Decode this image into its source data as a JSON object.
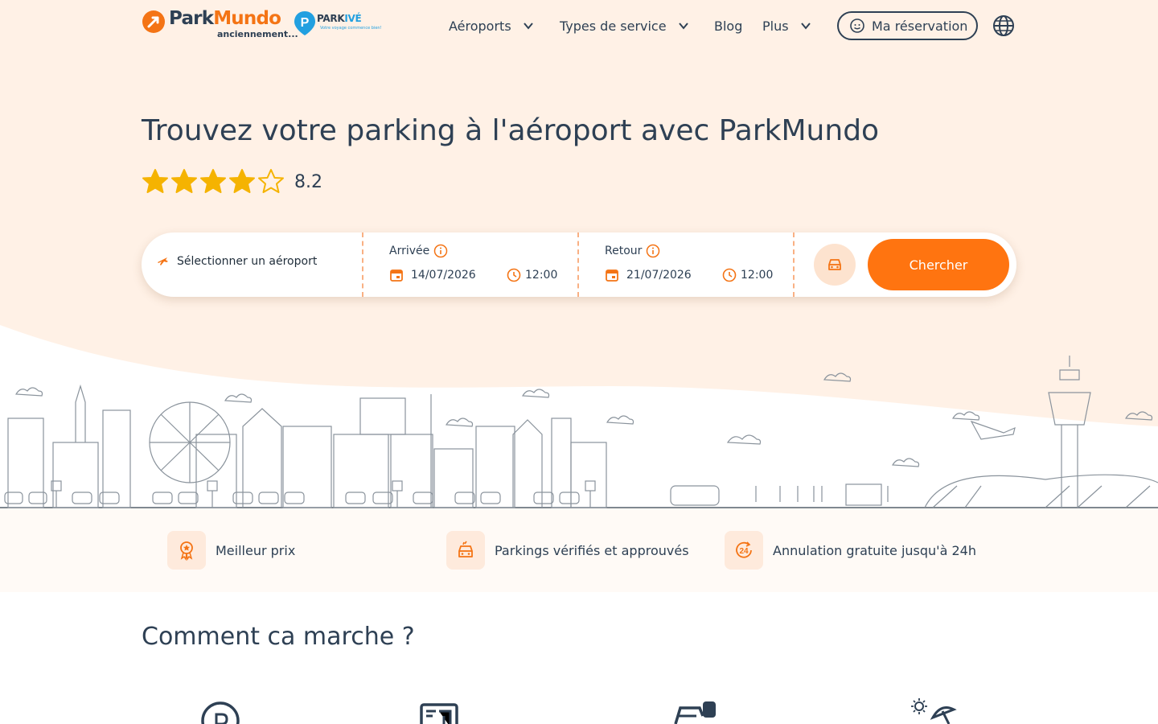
{
  "header": {
    "logo": {
      "name_main": "Park",
      "name_accent": "Mundo",
      "subtitle": "anciennement..."
    },
    "parkive": {
      "name_accent": "PARK",
      "name_rest": "IVÉ",
      "tagline": "Votre voyage commence bien!"
    },
    "nav": [
      {
        "label": "Aéroports",
        "has_dropdown": true
      },
      {
        "label": "Types de service",
        "has_dropdown": true
      },
      {
        "label": "Blog",
        "has_dropdown": false
      },
      {
        "label": "Plus",
        "has_dropdown": true
      }
    ],
    "reservation_label": "Ma réservation",
    "language_icon": "globe-icon"
  },
  "hero": {
    "title": "Trouvez votre parking à l'aéroport avec ParkMundo",
    "rating": {
      "value": "8.2",
      "stars": 4,
      "max_stars": 5
    }
  },
  "search": {
    "airport_placeholder": "Sélectionner un aéroport",
    "arrival": {
      "label": "Arrivée",
      "date": "14/07/2026",
      "time": "12:00"
    },
    "return": {
      "label": "Retour",
      "date": "21/07/2026",
      "time": "12:00"
    },
    "vehicle_icon": "car-icon",
    "submit_label": "Chercher"
  },
  "features": [
    {
      "label": "Meilleur prix",
      "icon": "award-ribbon-icon"
    },
    {
      "label": "Parkings vérifiés et approuvés",
      "icon": "verified-car-icon"
    },
    {
      "label": "Annulation gratuite jusqu'à 24h",
      "icon": "24h-icon"
    }
  ],
  "how_it_works": {
    "title": "Comment ca marche ?",
    "icons": [
      "parking-icon",
      "comparison-icon",
      "car-key-icon",
      "beach-sun-icon"
    ]
  },
  "colors": {
    "brand_orange": "#ff7410",
    "dark_text": "#2e4054",
    "hero_bg": "#fff1e6",
    "star_gold": "#f5b301"
  }
}
